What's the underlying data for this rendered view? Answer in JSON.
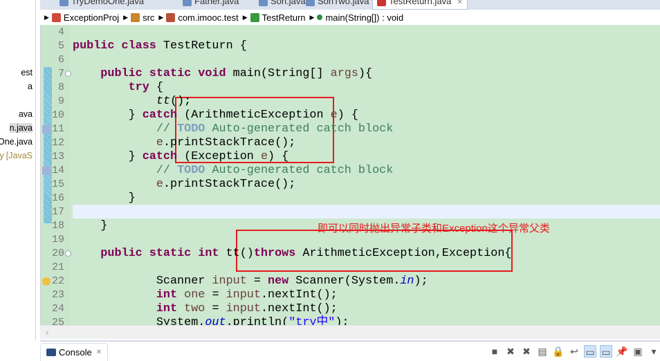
{
  "left_panel": {
    "items": [
      {
        "label": "est"
      },
      {
        "label": "a"
      },
      {
        "label": "ava"
      },
      {
        "label": "n.java"
      },
      {
        "label": "One.java"
      },
      {
        "label": "ary",
        "suffix": "[JavaS"
      }
    ]
  },
  "tabs": [
    {
      "label": "TryDemoOne.java"
    },
    {
      "label": "Father.java"
    },
    {
      "label": "Son.java"
    },
    {
      "label": "SonTwo.java"
    },
    {
      "label": "TestReturn.java",
      "active": true,
      "close": "✕"
    }
  ],
  "breadcrumb": [
    {
      "label": "ExceptionProj",
      "icon": "project-icon"
    },
    {
      "label": "src",
      "icon": "package-folder-icon"
    },
    {
      "label": "com.imooc.test",
      "icon": "package-icon"
    },
    {
      "label": "TestReturn",
      "icon": "class-icon"
    },
    {
      "label": "main(String[]) : void",
      "icon": "method-icon"
    }
  ],
  "lines": [
    {
      "n": "4",
      "t": []
    },
    {
      "n": "5",
      "t": [
        [
          "public class",
          "kw"
        ],
        [
          " TestReturn {",
          ""
        ]
      ]
    },
    {
      "n": "6",
      "t": []
    },
    {
      "n": "7",
      "t": [
        [
          "    ",
          ""
        ],
        [
          "public static void",
          "kw"
        ],
        [
          " main(String[] ",
          ""
        ],
        [
          "args",
          "var"
        ],
        [
          "){",
          ""
        ]
      ]
    },
    {
      "n": "8",
      "t": [
        [
          "        ",
          ""
        ],
        [
          "try",
          "kw"
        ],
        [
          " {",
          ""
        ]
      ]
    },
    {
      "n": "9",
      "t": [
        [
          "            ",
          ""
        ],
        [
          "tt",
          "it2"
        ],
        [
          "();",
          ""
        ]
      ]
    },
    {
      "n": "10",
      "t": [
        [
          "        } ",
          ""
        ],
        [
          "catch",
          "kw"
        ],
        [
          " (ArithmeticException ",
          ""
        ],
        [
          "e",
          "var"
        ],
        [
          ") {",
          ""
        ]
      ]
    },
    {
      "n": "11",
      "t": [
        [
          "            ",
          ""
        ],
        [
          "// ",
          "cm"
        ],
        [
          "TODO",
          "todo"
        ],
        [
          " Auto-generated catch block",
          "cm"
        ]
      ]
    },
    {
      "n": "12",
      "t": [
        [
          "            ",
          ""
        ],
        [
          "e",
          "var"
        ],
        [
          ".printStackTrace();",
          ""
        ]
      ]
    },
    {
      "n": "13",
      "t": [
        [
          "        } ",
          ""
        ],
        [
          "catch",
          "kw"
        ],
        [
          " (Exception ",
          ""
        ],
        [
          "e",
          "var"
        ],
        [
          ") {",
          ""
        ]
      ]
    },
    {
      "n": "14",
      "t": [
        [
          "            ",
          ""
        ],
        [
          "// ",
          "cm"
        ],
        [
          "TODO",
          "todo"
        ],
        [
          " Auto-generated catch block",
          "cm"
        ]
      ]
    },
    {
      "n": "15",
      "t": [
        [
          "            ",
          ""
        ],
        [
          "e",
          "var"
        ],
        [
          ".printStackTrace();",
          ""
        ]
      ]
    },
    {
      "n": "16",
      "t": [
        [
          "        }",
          ""
        ]
      ]
    },
    {
      "n": "17",
      "t": []
    },
    {
      "n": "18",
      "t": [
        [
          "    }",
          ""
        ]
      ]
    },
    {
      "n": "19",
      "t": []
    },
    {
      "n": "20",
      "t": [
        [
          "    ",
          ""
        ],
        [
          "public static int",
          "kw"
        ],
        [
          " tt()",
          ""
        ],
        [
          "throws",
          "kw"
        ],
        [
          " ArithmeticException,Exception{",
          ""
        ]
      ]
    },
    {
      "n": "21",
      "t": []
    },
    {
      "n": "22",
      "t": [
        [
          "            Scanner ",
          ""
        ],
        [
          "input",
          "var"
        ],
        [
          " = ",
          ""
        ],
        [
          "new",
          "kw"
        ],
        [
          " Scanner(System.",
          ""
        ],
        [
          "in",
          "fld"
        ],
        [
          ");",
          ""
        ]
      ]
    },
    {
      "n": "23",
      "t": [
        [
          "            ",
          ""
        ],
        [
          "int",
          "kw"
        ],
        [
          " ",
          ""
        ],
        [
          "one",
          "var"
        ],
        [
          " = ",
          ""
        ],
        [
          "input",
          "var"
        ],
        [
          ".nextInt();",
          ""
        ]
      ]
    },
    {
      "n": "24",
      "t": [
        [
          "            ",
          ""
        ],
        [
          "int",
          "kw"
        ],
        [
          " ",
          ""
        ],
        [
          "two",
          "var"
        ],
        [
          " = ",
          ""
        ],
        [
          "input",
          "var"
        ],
        [
          ".nextInt();",
          ""
        ]
      ]
    },
    {
      "n": "25",
      "t": [
        [
          "            System.",
          ""
        ],
        [
          "out",
          "fld"
        ],
        [
          ".println(",
          ""
        ],
        [
          "\"try中\"",
          "str"
        ],
        [
          ");",
          ""
        ]
      ]
    }
  ],
  "annotation": "即可以同时抛出异常子类和Exception这个异常父类",
  "annotation_color": "#e41b1b",
  "console": {
    "label": "Console",
    "close": "✕",
    "tools": [
      {
        "icon": "terminate-icon",
        "g": "■"
      },
      {
        "icon": "remove-launch-icon",
        "g": "✖"
      },
      {
        "icon": "remove-all-icon",
        "g": "✖"
      },
      {
        "icon": "clear-console-icon",
        "g": "▤"
      },
      {
        "icon": "scroll-lock-icon",
        "g": "🔒"
      },
      {
        "icon": "word-wrap-icon",
        "g": "↩"
      },
      {
        "icon": "show-on-stdout-icon",
        "g": "▭",
        "on": true
      },
      {
        "icon": "show-on-stderr-icon",
        "g": "▭",
        "on": true
      },
      {
        "icon": "pin-console-icon",
        "g": "📌"
      },
      {
        "icon": "display-console-icon",
        "g": "▣"
      },
      {
        "icon": "view-menu-icon",
        "g": "▾"
      }
    ]
  }
}
